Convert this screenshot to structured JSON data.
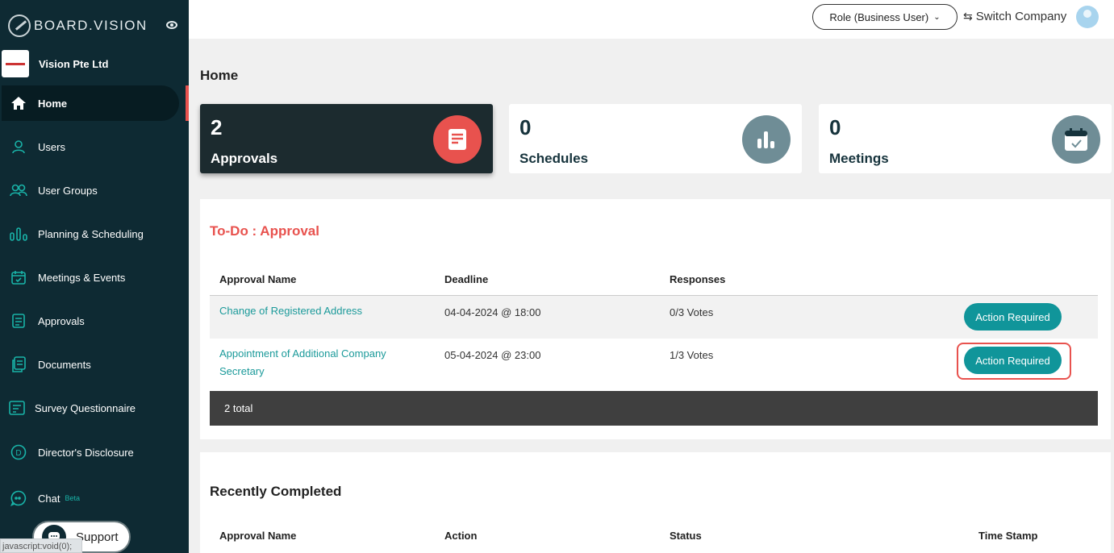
{
  "sidebar": {
    "brand": "BOARD.VISION",
    "company_name": "Vision Pte Ltd",
    "items": [
      {
        "label": "Home",
        "icon": "home-icon"
      },
      {
        "label": "Users",
        "icon": "user-icon"
      },
      {
        "label": "User Groups",
        "icon": "user-groups-icon"
      },
      {
        "label": "Planning & Scheduling",
        "icon": "planning-icon"
      },
      {
        "label": "Meetings & Events",
        "icon": "calendar-icon"
      },
      {
        "label": "Approvals",
        "icon": "approvals-icon"
      },
      {
        "label": "Documents",
        "icon": "documents-icon"
      },
      {
        "label": "Survey Questionnaire",
        "icon": "survey-icon"
      },
      {
        "label": "Director's Disclosure",
        "icon": "disclosure-icon"
      },
      {
        "label": "Chat",
        "icon": "chat-icon",
        "badge": "Beta"
      }
    ],
    "support_label": "Support",
    "status_url": "javascript:void(0);"
  },
  "topbar": {
    "role_label": "Role (Business User)",
    "switch_company_label": "Switch Company"
  },
  "page": {
    "title": "Home"
  },
  "cards": [
    {
      "count": "2",
      "label": "Approvals",
      "icon": "document-icon"
    },
    {
      "count": "0",
      "label": "Schedules",
      "icon": "bar-chart-icon"
    },
    {
      "count": "0",
      "label": "Meetings",
      "icon": "calendar-check-icon"
    }
  ],
  "todo": {
    "title": "To-Do : Approval",
    "columns": [
      "Approval Name",
      "Deadline",
      "Responses"
    ],
    "rows": [
      {
        "name": "Change of Registered Address",
        "deadline": "04-04-2024 @ 18:00",
        "responses": "0/3 Votes",
        "action": "Action Required"
      },
      {
        "name": "Appointment of Additional Company Secretary",
        "deadline": "05-04-2024 @ 23:00",
        "responses": "1/3 Votes",
        "action": "Action Required"
      }
    ],
    "total": "2 total"
  },
  "completed": {
    "title": "Recently Completed",
    "columns": [
      "Approval Name",
      "Action",
      "Status",
      "Time Stamp"
    ]
  },
  "colors": {
    "sidebar_bg": "#0e2a33",
    "accent_teal": "#10959a",
    "accent_red": "#e8524e"
  }
}
